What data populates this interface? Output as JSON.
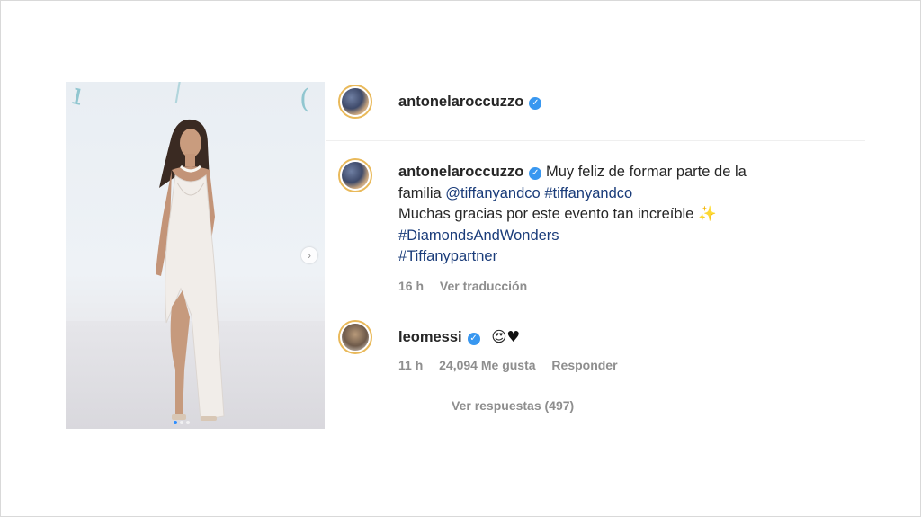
{
  "post": {
    "author": "antonelaroccuzzo",
    "caption": {
      "author": "antonelaroccuzzo",
      "line1": "Muy feliz de formar parte de la",
      "line2_prefix": "familia",
      "mention": "@tiffanyandco",
      "hashtag1": "#tiffanyandco",
      "line3": "Muchas gracias por este evento tan increíble",
      "sparkle": "✨",
      "hashtag2": "#DiamondsAndWonders",
      "hashtag3": "#Tiffanypartner",
      "time": "16 h",
      "translate": "Ver traducción"
    },
    "carousel": {
      "next": "›"
    }
  },
  "comment": {
    "user": "leomessi",
    "emojis": "😍",
    "heart": "♥",
    "time": "11 h",
    "likes": "24,094 Me gusta",
    "reply": "Responder",
    "view_replies": "Ver respuestas (497)"
  },
  "colors": {
    "verified": "#3897f0",
    "link": "#1a3c7a",
    "meta": "#8e8e8e"
  },
  "icons": {
    "verified": "verified-badge-icon",
    "next": "chevron-right-icon"
  }
}
